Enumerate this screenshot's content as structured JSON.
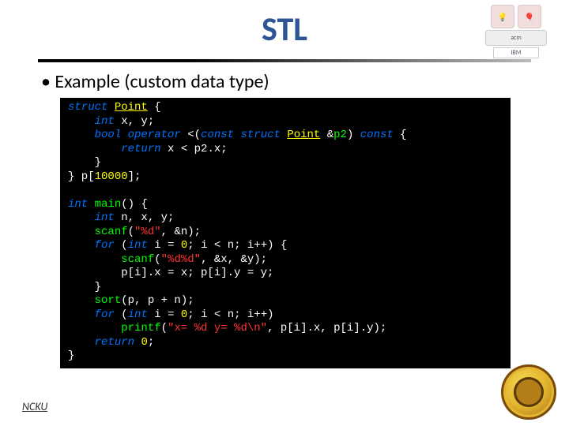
{
  "title": "STL",
  "bullet": "• Example (custom data type)",
  "footer": "NCKU",
  "logos": {
    "acm": "acm",
    "ibm": "IBM"
  },
  "code": {
    "l1a": "struct",
    "l1b": "Point",
    "l1c": " {",
    "l2a": "int",
    "l2b": " x, y;",
    "l3a": "bool",
    "l3b": "operator",
    "l3c": " <(",
    "l3d": "const",
    "l3e": "struct",
    "l3f": "Point",
    "l3g": " &",
    "l3h": "p2",
    "l3i": ") ",
    "l3j": "const",
    "l3k": " {",
    "l4a": "return",
    "l4b": " x < p2.x;",
    "l5": "}",
    "l6a": "} p[",
    "l6b": "10000",
    "l6c": "];",
    "blank1": "",
    "l7a": "int",
    "l7b": "main",
    "l7c": "() {",
    "l8a": "int",
    "l8b": " n, x, y;",
    "l9a": "scanf",
    "l9b": "(",
    "l9c": "\"%d\"",
    "l9d": ", &n);",
    "l10a": "for",
    "l10b": " (",
    "l10c": "int",
    "l10d": " i = ",
    "l10e": "0",
    "l10f": "; i < n; i++) {",
    "l11a": "scanf",
    "l11b": "(",
    "l11c": "\"%d%d\"",
    "l11d": ", &x, &y);",
    "l12": "p[i].x = x; p[i].y = y;",
    "l13": "}",
    "l14a": "sort",
    "l14b": "(p, p + n);",
    "l15a": "for",
    "l15b": " (",
    "l15c": "int",
    "l15d": " i = ",
    "l15e": "0",
    "l15f": "; i < n; i++)",
    "l16a": "printf",
    "l16b": "(",
    "l16c": "\"x= %d y= %d\\n\"",
    "l16d": ", p[i].x, p[i].y);",
    "l17a": "return",
    "l17b": "0",
    "l17c": ";",
    "l18": "}"
  }
}
